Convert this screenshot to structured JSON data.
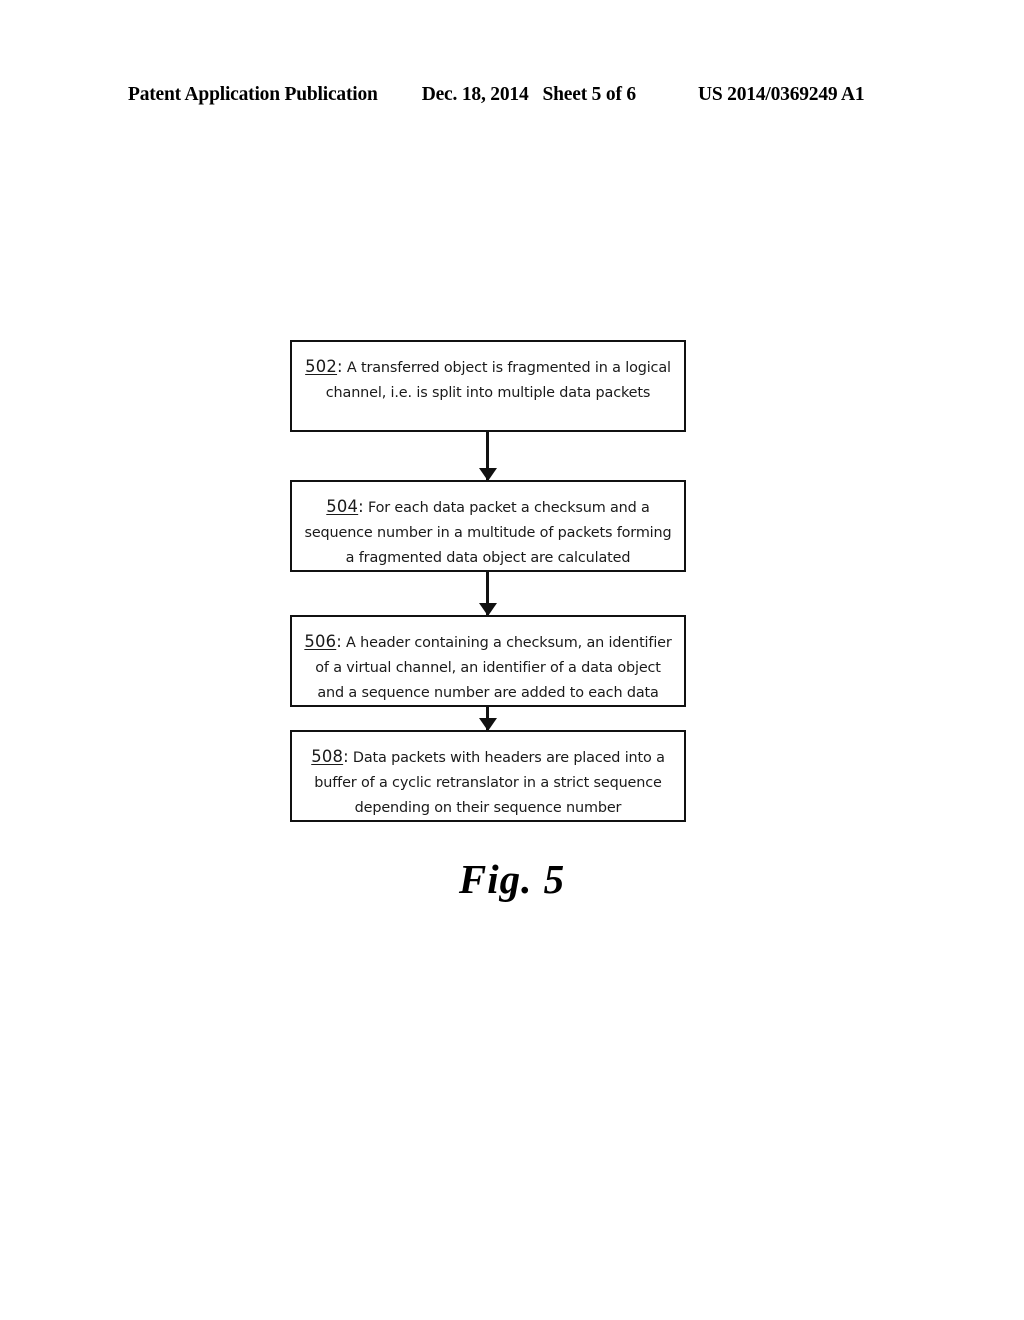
{
  "header": {
    "publication": "Patent Application Publication",
    "date": "Dec. 18, 2014",
    "sheet": "Sheet 5 of 6",
    "doc_id": "US 2014/0369249 A1"
  },
  "figure": {
    "caption": "Fig. 5",
    "steps": [
      {
        "id": "502",
        "number": "502",
        "colon": ":",
        "text": " A transferred object is fragmented in a logical\nchannel, i.e. is split into multiple data packets",
        "full_text": "502: A transferred object is fragmented in a logical channel, i.e. is split into multiple data packets"
      },
      {
        "id": "504",
        "number": "504",
        "colon": ":",
        "text": " For each data packet a checksum and a\nsequence number in a multitude of packets forming\na fragmented data object are calculated",
        "full_text": "504: For each data packet a checksum and a sequence number in a multitude of packets forming a fragmented data object are calculated"
      },
      {
        "id": "506",
        "number": "506",
        "colon": ":",
        "text": " A header containing a checksum, an identifier\nof a virtual channel, an identifier of a data object\nand a sequence number are added to each data",
        "full_text": "506: A header containing a checksum, an identifier of a virtual channel, an identifier of a data object and a sequence number are added to each data"
      },
      {
        "id": "508",
        "number": "508",
        "colon": ":",
        "text": " Data packets with headers are placed into a\nbuffer of a cyclic retranslator in a strict sequence\ndepending on their sequence number",
        "full_text": "508: Data packets with headers are placed into a buffer of a cyclic retranslator in a strict sequence depending on their sequence number"
      }
    ]
  },
  "colors": {
    "ink": "#111111",
    "text": "#1a1a1a",
    "page_background": "#ffffff"
  }
}
